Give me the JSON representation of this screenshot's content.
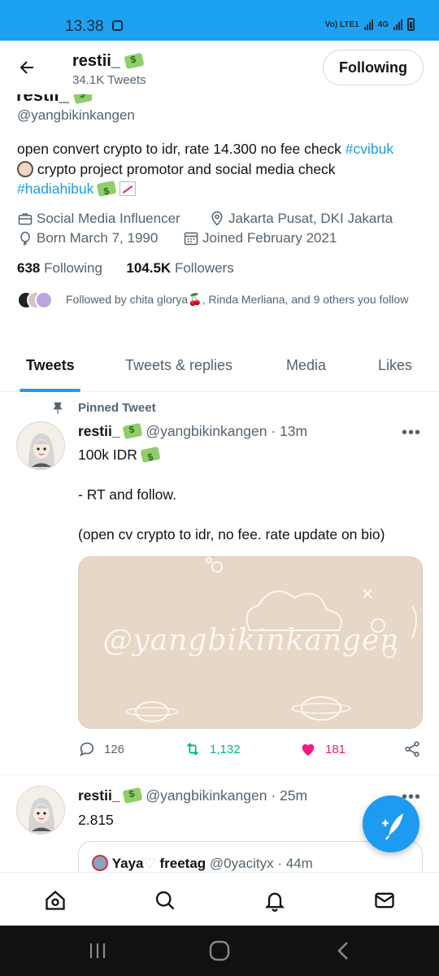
{
  "status_bar": {
    "time": "13.38",
    "network_label": "Vo) LTE1",
    "network_type": "4G"
  },
  "header": {
    "name": "restii_",
    "tweet_count": "34.1K Tweets",
    "follow_button": "Following"
  },
  "profile": {
    "name": "restii_",
    "handle": "@yangbikinkangen",
    "bio_line1_text": "open convert crypto to idr, rate 14.300 no fee check ",
    "bio_tag1": "#cvibuk",
    "bio_line2_text": " crypto project promotor and social media check",
    "bio_tag2": "#hadiahibuk",
    "category": "Social Media Influencer",
    "location": "Jakarta Pusat, DKI Jakarta",
    "born": "Born March 7, 1990",
    "joined": "Joined February 2021",
    "following_count": "638",
    "following_label": "Following",
    "followers_count": "104.5K",
    "followers_label": "Followers",
    "followed_by": "Followed by chita glorya🍒, Rinda Merliana, and 9 others you follow"
  },
  "tabs": [
    {
      "label": "Tweets",
      "active": true
    },
    {
      "label": "Tweets & replies",
      "active": false
    },
    {
      "label": "Media",
      "active": false
    },
    {
      "label": "Likes",
      "active": false
    }
  ],
  "tweets": [
    {
      "pinned_label": "Pinned Tweet",
      "name": "restii_",
      "handle": "@yangbikinkangen",
      "time": "· 13m",
      "line1": "100k IDR",
      "line2": "- RT and follow.",
      "line3": "(open cv crypto to idr, no fee. rate update on bio)",
      "media_text": "@yangbikinkangen",
      "replies": "126",
      "retweets": "1,132",
      "likes": "181",
      "colors": {
        "retweet": "#00ba7c",
        "like": "#f91880"
      }
    },
    {
      "name": "restii_",
      "handle": "@yangbikinkangen",
      "time": "· 25m",
      "text": "2.815",
      "quote": {
        "name": "Yaya",
        "name2": "freetag",
        "handle": "@0yacityx",
        "time": "· 44m"
      }
    }
  ],
  "more_label": "•••",
  "icons": {
    "back": "arrow-left-icon",
    "home": "home-icon",
    "search": "search-icon",
    "notifications": "bell-icon",
    "messages": "mail-icon",
    "compose": "compose-feather-icon"
  },
  "accent": "#1d9bf0"
}
